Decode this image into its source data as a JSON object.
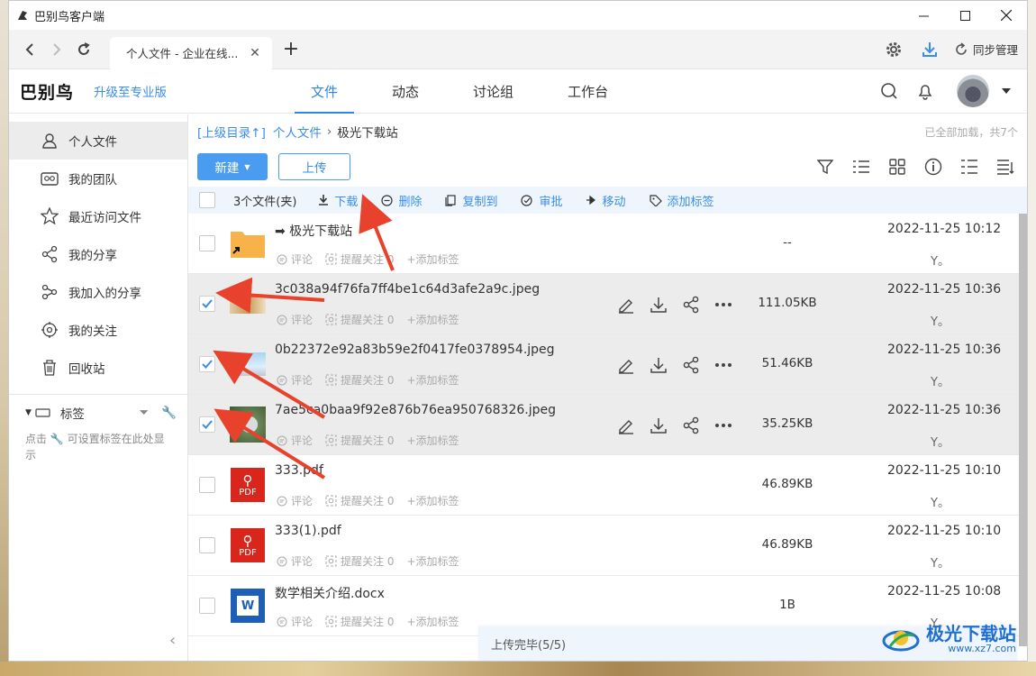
{
  "window": {
    "title": "巴别鸟客户端"
  },
  "browser": {
    "tab_title": "个人文件 - 企业在线...",
    "sync_label": "同步管理"
  },
  "header": {
    "brand": "巴别鸟",
    "upgrade": "升级至专业版",
    "nav": [
      "文件",
      "动态",
      "讨论组",
      "工作台"
    ]
  },
  "sidebar": {
    "items": [
      "个人文件",
      "我的团队",
      "最近访问文件",
      "我的分享",
      "我加入的分享",
      "我的关注",
      "回收站"
    ],
    "tags_label": "标签",
    "tags_hint": "点击 🔧 可设置标签在此处显示"
  },
  "breadcrumb": {
    "up": "[上级目录↑]",
    "parent": "个人文件",
    "sep": "›",
    "current": "极光下载站",
    "loaded": "已全部加载，共7个"
  },
  "toolbar": {
    "new": "新建",
    "upload": "上传"
  },
  "actionbar": {
    "count": "3个文件(夹)",
    "download": "下载",
    "delete": "删除",
    "copy": "复制到",
    "approve": "审批",
    "move": "移动",
    "tag": "添加标签"
  },
  "meta": {
    "comment": "评论",
    "follow": "提醒关注 0",
    "add_tag": "+添加标签"
  },
  "files": [
    {
      "name": "➡ 极光下载站",
      "size": "--",
      "date": "2022-11-25 10:12",
      "owner": "Y。",
      "type": "folder",
      "checked": false
    },
    {
      "name": "3c038a94f76fa7ff4be1c64d3afe2a9c.jpeg",
      "size": "111.05KB",
      "date": "2022-11-25 10:36",
      "owner": "Y。",
      "type": "image1",
      "checked": true
    },
    {
      "name": "0b22372e92a83b59e2f0417fe0378954.jpeg",
      "size": "51.46KB",
      "date": "2022-11-25 10:36",
      "owner": "Y。",
      "type": "image2",
      "checked": true
    },
    {
      "name": "7ae5ca0baa9f92e876b76ea950768326.jpeg",
      "size": "35.25KB",
      "date": "2022-11-25 10:36",
      "owner": "Y。",
      "type": "image3",
      "checked": true
    },
    {
      "name": "333.pdf",
      "size": "46.89KB",
      "date": "2022-11-25 10:10",
      "owner": "Y。",
      "type": "pdf",
      "checked": false
    },
    {
      "name": "333(1).pdf",
      "size": "46.89KB",
      "date": "2022-11-25 10:10",
      "owner": "Y。",
      "type": "pdf",
      "checked": false
    },
    {
      "name": "数学相关介绍.docx",
      "size": "1B",
      "date": "2022-11-25 10:08",
      "owner": "Y。",
      "type": "docx",
      "checked": false
    }
  ],
  "pdf_label": "PDF",
  "toast": "上传完毕(5/5)",
  "watermark": {
    "name": "极光下载站",
    "url": "www.xz7.com"
  },
  "colors": {
    "accent": "#2f86e5",
    "annotation_arrow": "#e8412c"
  }
}
